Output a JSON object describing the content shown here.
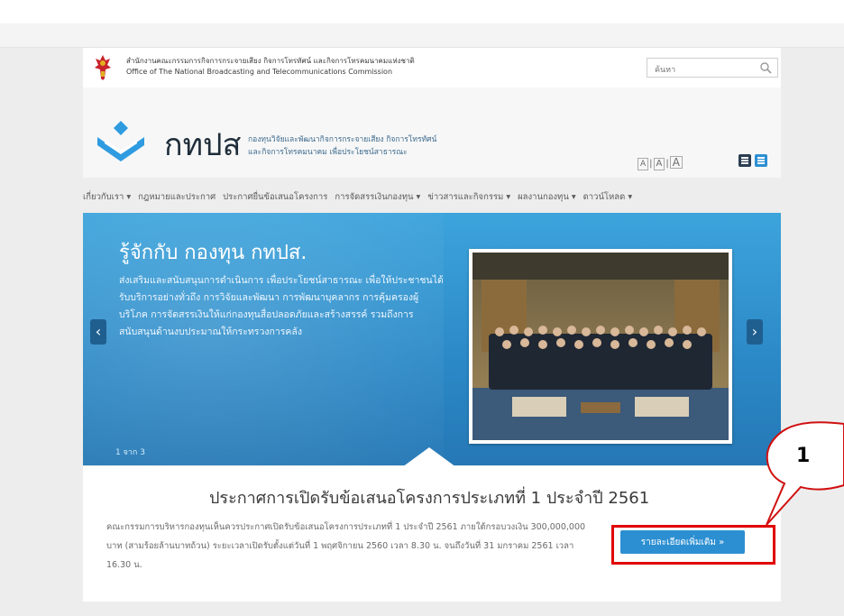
{
  "header": {
    "org_th": "สำนักงานคณะกรรมการกิจการกระจายเสียง กิจการโทรทัศน์ และกิจการโทรคมนาคมแห่งชาติ",
    "org_en": "Office of The National Broadcasting and Telecommunications Commission",
    "search_placeholder": "ค้นหา"
  },
  "brand": {
    "logo_text": "กทปส",
    "tagline_line1": "กองทุนวิจัยและพัฒนากิจการกระจายเสียง กิจการโทรทัศน์",
    "tagline_line2": "และกิจการโทรคมนาคม เพื่อประโยชน์สาธารณะ",
    "font_size_controls": [
      "A",
      "A",
      "A"
    ]
  },
  "nav": {
    "items": [
      {
        "label": "เกี่ยวกับเรา ▾"
      },
      {
        "label": "กฎหมายและประกาศ"
      },
      {
        "label": "ประกาศยื่นข้อเสนอโครงการ"
      },
      {
        "label": "การจัดสรรเงินกองทุน ▾"
      },
      {
        "label": "ข่าวสารและกิจกรรม ▾"
      },
      {
        "label": "ผลงานกองทุน ▾"
      },
      {
        "label": "ดาวน์โหลด ▾"
      }
    ]
  },
  "hero": {
    "title": "รู้จักกับ กองทุน กทปส.",
    "body": "ส่งเสริมและสนับสนุนการดำเนินการ เพื่อประโยชน์สาธารณะ เพื่อให้ประชาชนได้รับบริการอย่างทั่วถึง การวิจัยและพัฒนา การพัฒนาบุคลากร การคุ้มครองผู้บริโภค การจัดสรรเงินให้แก่กองทุนสื่อปลอดภัยและสร้างสรรค์ รวมถึงการสนับสนุนด้านงบประมาณให้กระทรวงการคลัง",
    "pager": "1 จาก 3",
    "prev_icon": "‹",
    "next_icon": "›"
  },
  "announcement": {
    "title": "ประกาศการเปิดรับข้อเสนอโครงการประเภทที่ 1 ประจำปี 2561",
    "body": "คณะกรรมการบริหารกองทุนเห็นควรประกาศเปิดรับข้อเสนอโครงการประเภทที่ 1 ประจำปี 2561 ภายใต้กรอบวงเงิน 300,000,000 บาท (สามร้อยล้านบาทถ้วน) ระยะเวลาเปิดรับตั้งแต่วันที่ 1 พฤศจิกายน 2560 เวลา 8.30 น. จนถึงวันที่ 31 มกราคม 2561 เวลา 16.30 น.",
    "more_button": "รายละเอียดเพิ่มเติม »"
  },
  "annotation": {
    "callout_number": "1"
  },
  "colors": {
    "hero_blue": "#2b88c6",
    "button_blue": "#2c8fd2",
    "highlight_red": "#e00000"
  }
}
